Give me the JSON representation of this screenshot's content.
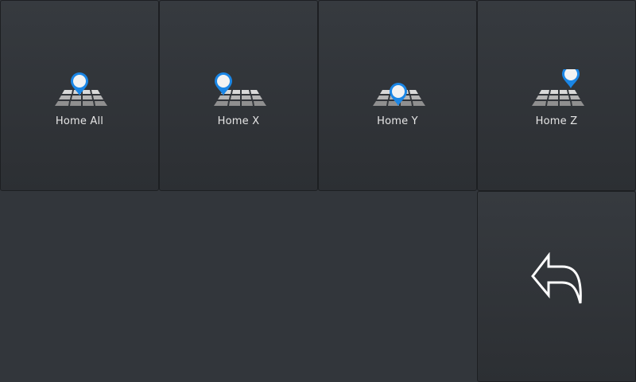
{
  "home_buttons": [
    {
      "label": "Home All",
      "icon": "home-all-icon"
    },
    {
      "label": "Home X",
      "icon": "home-x-icon"
    },
    {
      "label": "Home Y",
      "icon": "home-y-icon"
    },
    {
      "label": "Home Z",
      "icon": "home-z-icon"
    }
  ],
  "back_button": {
    "icon": "back-arrow-icon"
  },
  "colors": {
    "background": "#32363b",
    "tile_top": "#363a3f",
    "tile_bottom": "#2c2f33",
    "pin_blue": "#1a86e6",
    "label": "#e6e6e6"
  }
}
